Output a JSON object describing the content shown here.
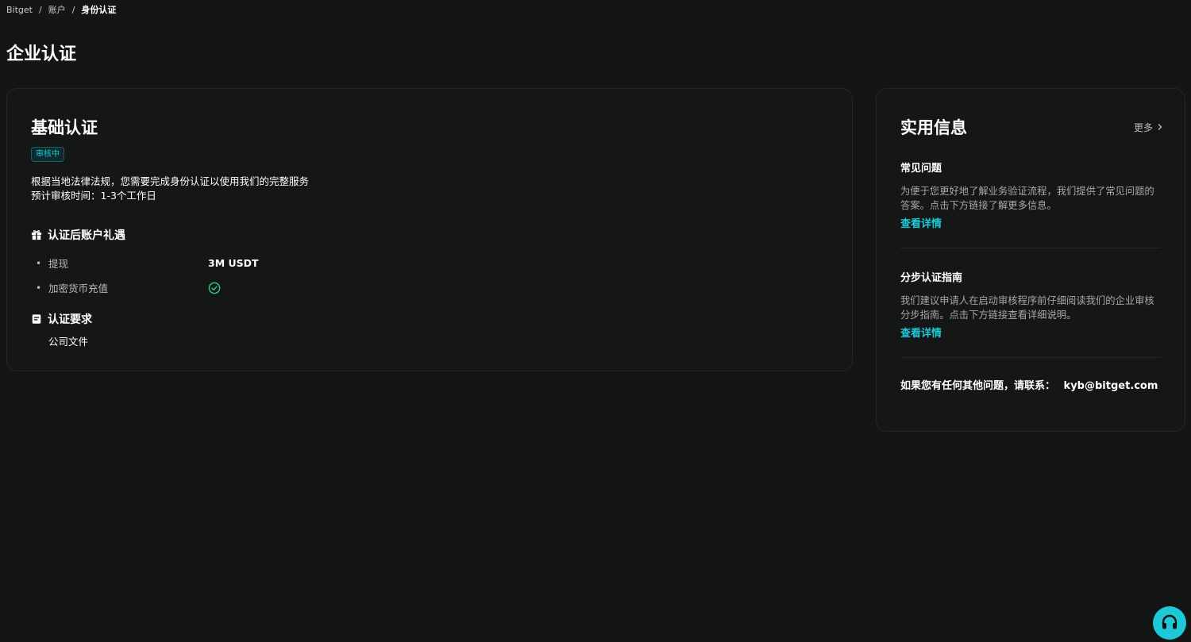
{
  "breadcrumb": {
    "items": [
      "Bitget",
      "账户",
      "身份认证"
    ],
    "separator": "/"
  },
  "page_title": "企业认证",
  "main_card": {
    "title": "基础认证",
    "status": "审核中",
    "desc_line1": "根据当地法律法规，您需要完成身份认证以使用我们的完整服务",
    "desc_line2": "预计审核时间：1-3个工作日",
    "benefits": {
      "heading": "认证后账户礼遇",
      "icon": "gift-icon",
      "items": [
        {
          "label": "提现",
          "value": "3M USDT"
        },
        {
          "label": "加密货币充值",
          "value_icon": "check-circle-icon"
        }
      ]
    },
    "requirements": {
      "heading": "认证要求",
      "icon": "document-icon",
      "item": "公司文件"
    }
  },
  "side_card": {
    "title": "实用信息",
    "more": "更多",
    "faq": {
      "title": "常见问题",
      "text": "为便于您更好地了解业务验证流程，我们提供了常见问题的答案。点击下方链接了解更多信息。",
      "link": "查看详情"
    },
    "guide": {
      "title": "分步认证指南",
      "text": "我们建议申请人在启动审核程序前仔细阅读我们的企业审核分步指南。点击下方链接查看详细说明。",
      "link": "查看详情"
    },
    "contact_label": "如果您有任何其他问题，请联系：",
    "contact_email": "kyb@bitget.com"
  },
  "colors": {
    "background": "#141515",
    "accent": "#1dc8d8",
    "success": "#2ec27e"
  },
  "support_icon": "headset-icon"
}
